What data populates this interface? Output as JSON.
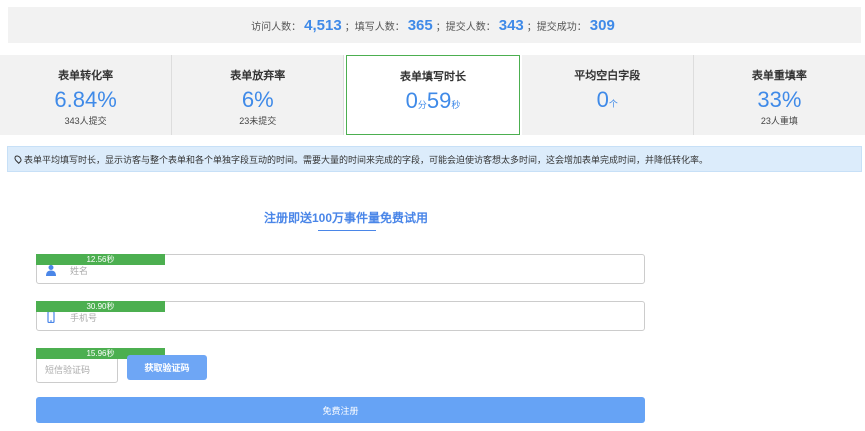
{
  "summary": {
    "visits_label": "访问人数：",
    "visits": "4,513",
    "fill_label": "；填写人数：",
    "fill": "365",
    "submit_label": "；提交人数：",
    "submit": "343",
    "success_label": "；提交成功：",
    "success": "309"
  },
  "cards": [
    {
      "title": "表单转化率",
      "value": "6.84%",
      "sub": "343人提交"
    },
    {
      "title": "表单放弃率",
      "value": "6%",
      "sub": "23未提交"
    },
    {
      "title": "表单填写时长",
      "min": "0",
      "min_unit": "分",
      "sec": "59",
      "sec_unit": "秒"
    },
    {
      "title": "平均空白字段",
      "value": "0",
      "unit": "个"
    },
    {
      "title": "表单重填率",
      "value": "33%",
      "sub": "23人重填"
    }
  ],
  "tip": "表单平均填写时长，显示访客与整个表单和各个单独字段互动的时间。需要大量的时间来完成的字段，可能会迫使访客想太多时间，这会增加表单完成时间，并降低转化率。",
  "form": {
    "title": "注册即送100万事件量免费试用",
    "name_placeholder": "姓名",
    "name_time": "12.56秒",
    "phone_placeholder": "手机号",
    "phone_time": "30.90秒",
    "code_placeholder": "短信验证码",
    "code_time": "15.96秒",
    "code_button": "获取验证码",
    "submit_button": "免费注册"
  },
  "colors": {
    "accent": "#3f8ae8",
    "badge": "#4caf50",
    "button": "#66a3f5"
  },
  "icons": [
    "map-pin-icon",
    "user-icon",
    "phone-icon"
  ]
}
